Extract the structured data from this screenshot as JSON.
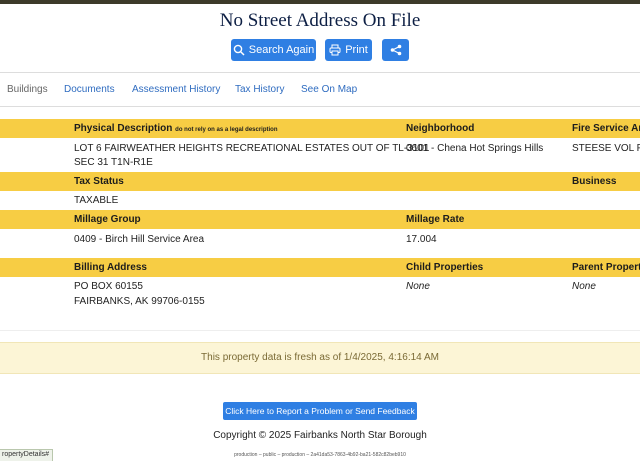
{
  "page": {
    "title": "No Street Address On File"
  },
  "actions": {
    "search_label": "Search Again",
    "print_label": "Print"
  },
  "tabs": [
    "Buildings",
    "Documents",
    "Assessment History",
    "Tax History",
    "See On Map"
  ],
  "sections": {
    "physical_description": {
      "label": "Physical Description",
      "note": "do not rely on as a legal description",
      "value_line1": "LOT 6 FAIRWEATHER HEIGHTS RECREATIONAL ESTATES OUT OF TL-3101",
      "value_line2": "SEC 31 T1N-R1E"
    },
    "neighborhood": {
      "label": "Neighborhood",
      "value": "0601 - Chena Hot Springs Hills"
    },
    "fire_service_area": {
      "label": "Fire Service Are",
      "value": "STEESE VOL FIR"
    },
    "tax_status": {
      "label": "Tax Status",
      "value": "TAXABLE"
    },
    "business": {
      "label": "Business"
    },
    "millage_group": {
      "label": "Millage Group",
      "value": "0409 - Birch Hill Service Area"
    },
    "millage_rate": {
      "label": "Millage Rate",
      "value": "17.004"
    },
    "billing_address": {
      "label": "Billing Address",
      "line1": "PO BOX 60155",
      "line2": "FAIRBANKS, AK 99706-0155"
    },
    "child_properties": {
      "label": "Child Properties",
      "value": "None"
    },
    "parent_properties": {
      "label": "Parent Properti",
      "value": "None"
    }
  },
  "freshness": {
    "text": "This property data is fresh as of 1/4/2025, 4:16:14 AM"
  },
  "footer": {
    "feedback_label": "Click Here to Report a Problem or Send Feedback",
    "copyright": "Copyright © 2025 Fairbanks North Star Borough",
    "build": "production – public – production – 2a41da53-7863-4b92-ba21-582c82beb910"
  },
  "statusbar": {
    "link": "ropertyDetails#"
  },
  "colors": {
    "accent": "#2f7fe3",
    "band": "#f7cd44",
    "fresh_bg": "#fcf5d6",
    "title": "#0d1f44"
  },
  "icons": {
    "search": "magnifier-icon",
    "print": "printer-icon",
    "share": "share-icon"
  }
}
